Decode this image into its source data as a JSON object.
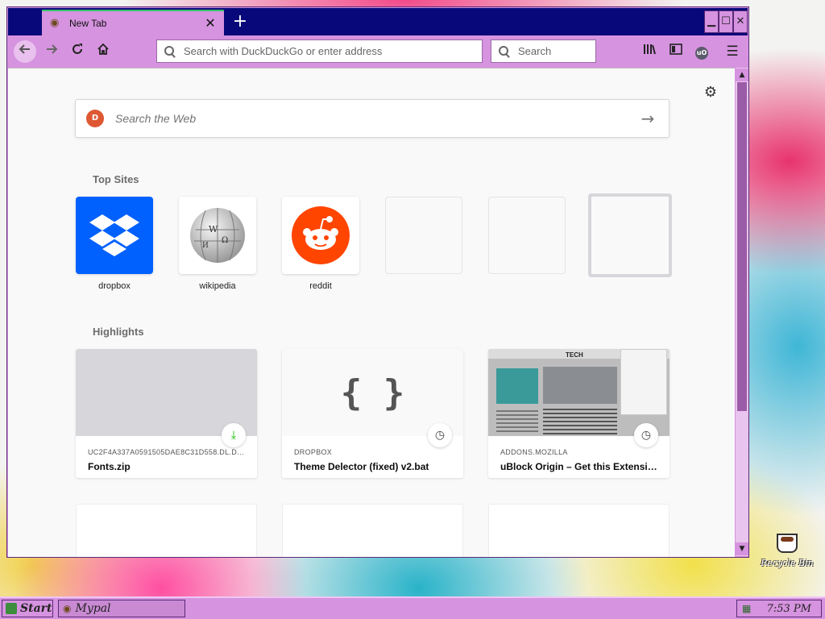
{
  "browser": {
    "tab": {
      "title": "New Tab",
      "close_label": "✕",
      "favicon": "mypal-icon"
    },
    "new_tab_label": "+",
    "window_controls": {
      "minimize": "▁",
      "maximize": "☐",
      "close": "✕"
    },
    "nav": {
      "back": "🡐",
      "forward": "🡒",
      "reload": "⟳",
      "home": "⌂"
    },
    "urlbar": {
      "placeholder": "Search with DuckDuckGo or enter address",
      "value": ""
    },
    "searchbar": {
      "placeholder": "Search",
      "value": ""
    },
    "toolbar_icons": {
      "library": "|||\\",
      "sidebar": "▥",
      "ublock": "uO",
      "menu": "☰"
    }
  },
  "newtab": {
    "settings_icon": "⚙",
    "websearch": {
      "placeholder": "Search the Web",
      "go": "→",
      "logo": "D"
    },
    "top_sites_title": "Top Sites",
    "top_sites": [
      {
        "label": "dropbox"
      },
      {
        "label": "wikipedia"
      },
      {
        "label": "reddit"
      },
      {
        "label": ""
      },
      {
        "label": ""
      },
      {
        "label": ""
      }
    ],
    "highlights_title": "Highlights",
    "highlights": [
      {
        "source": "UC2F4A337A0591505DAE8C31D558.DL.DR...",
        "title": "Fonts.zip",
        "badge": "download-icon",
        "badge_glyph": "⤓"
      },
      {
        "source": "DROPBOX",
        "title": "Theme Delector (fixed) v2.bat",
        "badge": "clock-icon",
        "badge_glyph": "◷",
        "thumb_text": "{ }"
      },
      {
        "source": "ADDONS.MOZILLA",
        "title": "uBlock Origin – Get this Extensio...",
        "badge": "clock-icon",
        "badge_glyph": "◷",
        "thumb_heading": "TECH"
      }
    ]
  },
  "desktop": {
    "recycle_bin_label": "Recycle Bin"
  },
  "taskbar": {
    "start_label": "Start",
    "task_label": "Mypal",
    "clock": "7:53 PM"
  },
  "colors": {
    "window_frame": "#d693df",
    "titlebar": "#08087a",
    "dropbox_blue": "#0061fe",
    "reddit_orange": "#ff4500",
    "download_green": "#12bc00"
  }
}
